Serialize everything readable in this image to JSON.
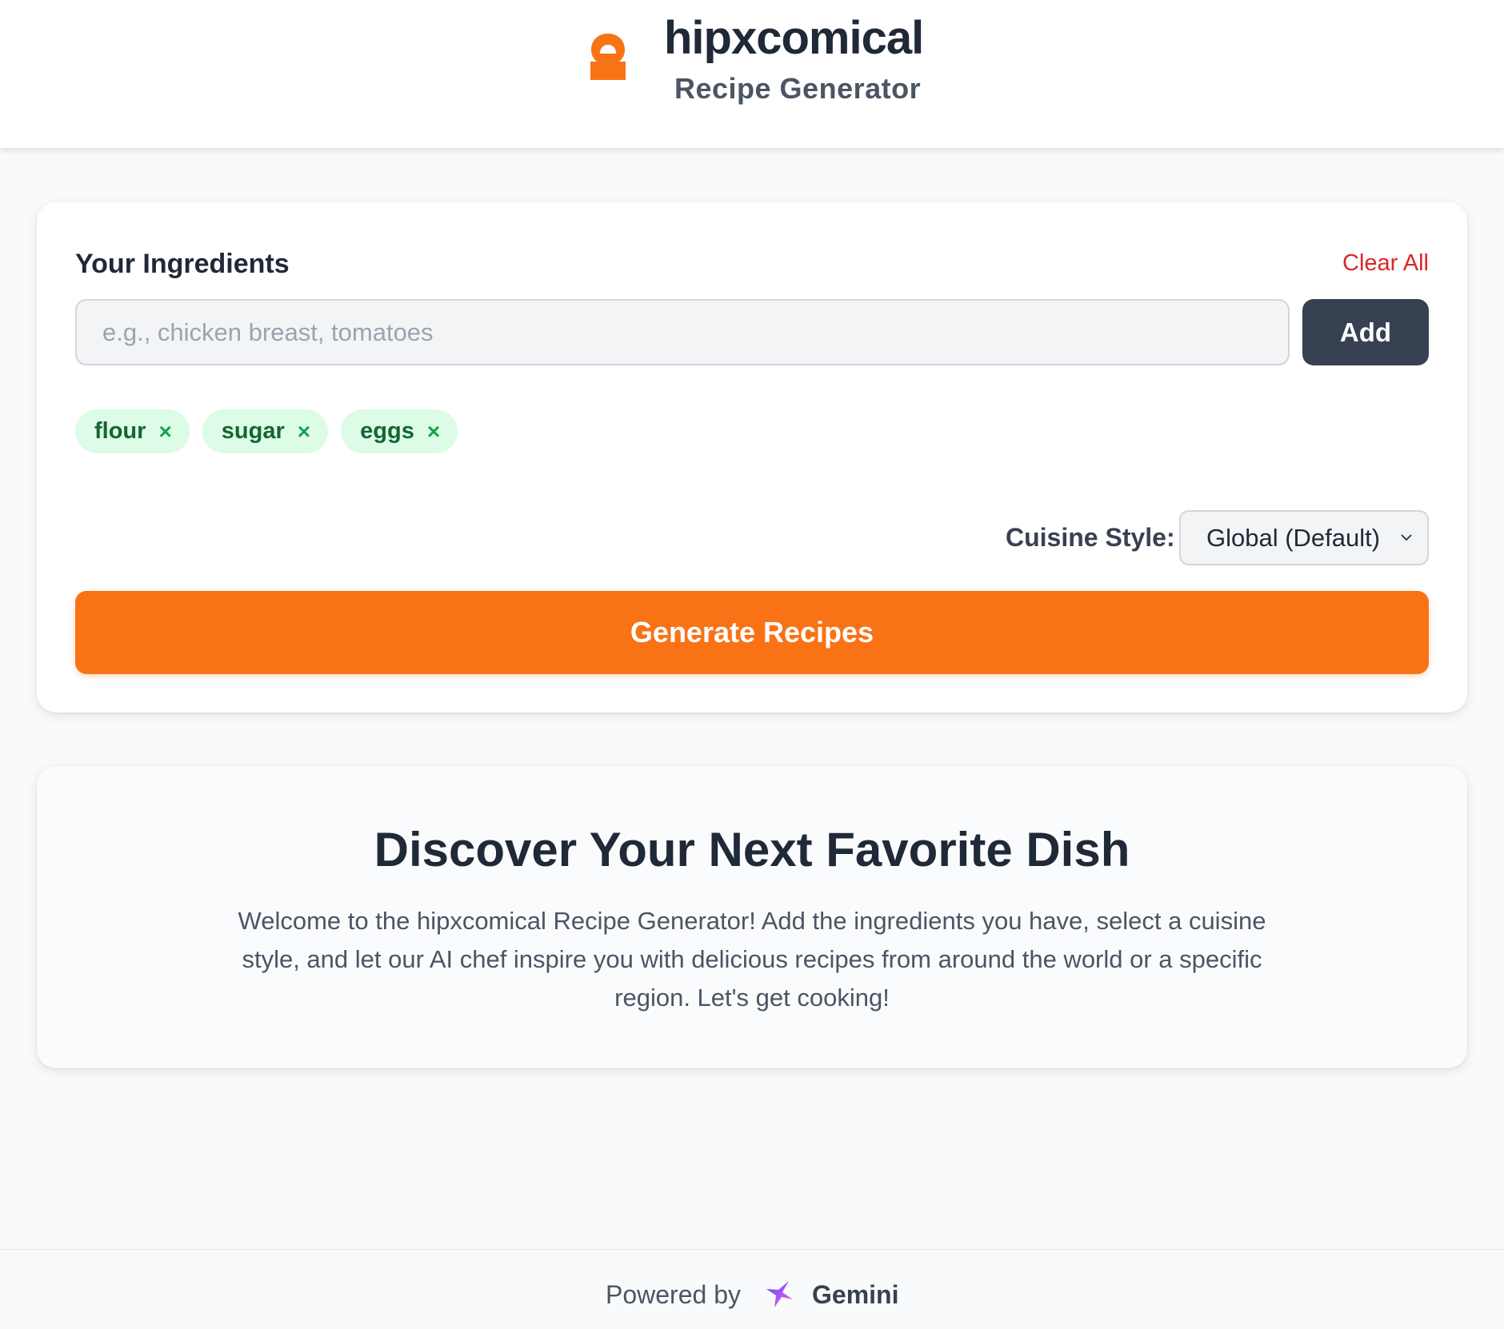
{
  "header": {
    "brand": "hipxcomical",
    "subtitle": "Recipe Generator",
    "logo_icon": "chef-hat-icon",
    "accent_color": "#f97316"
  },
  "ingredients": {
    "label": "Your Ingredients",
    "clear_all_label": "Clear All",
    "input_placeholder": "e.g., chicken breast, tomatoes",
    "input_value": "",
    "add_label": "Add",
    "tags": [
      {
        "label": "flour",
        "remove": "×"
      },
      {
        "label": "sugar",
        "remove": "×"
      },
      {
        "label": "eggs",
        "remove": "×"
      }
    ]
  },
  "cuisine": {
    "label": "Cuisine Style:",
    "selected": "Global (Default)"
  },
  "generate_label": "Generate Recipes",
  "welcome": {
    "title": "Discover Your Next Favorite Dish",
    "text": "Welcome to the hipxcomical Recipe Generator! Add the ingredients you have, select a cuisine style, and let our AI chef inspire you with delicious recipes from around the world or a specific region. Let's get cooking!"
  },
  "footer": {
    "powered_by": "Powered by",
    "provider": "Gemini",
    "provider_icon": "gemini-star-icon"
  }
}
